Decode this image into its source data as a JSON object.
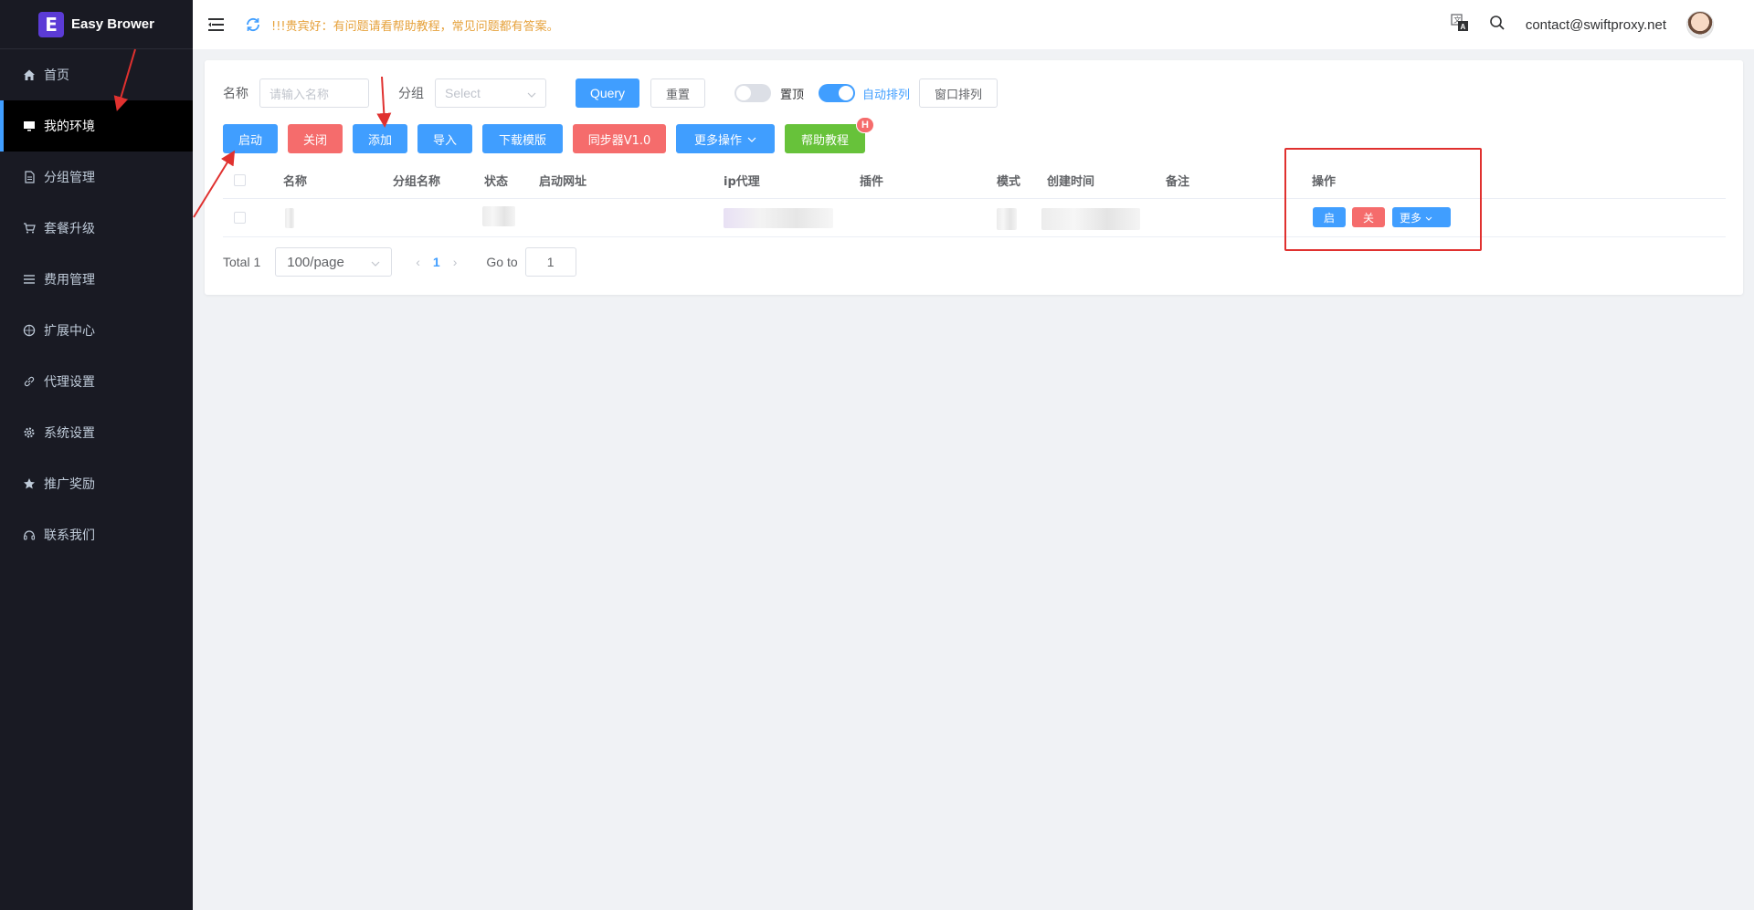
{
  "app": {
    "logo_letter": "E",
    "logo_text": "Easy Brower"
  },
  "sidebar": {
    "items": [
      {
        "label": "首页",
        "icon": "home-icon"
      },
      {
        "label": "我的环境",
        "icon": "monitor-icon",
        "active": true
      },
      {
        "label": "分组管理",
        "icon": "document-icon"
      },
      {
        "label": "套餐升级",
        "icon": "cart-icon"
      },
      {
        "label": "费用管理",
        "icon": "list-icon"
      },
      {
        "label": "扩展中心",
        "icon": "compass-icon"
      },
      {
        "label": "代理设置",
        "icon": "link-icon"
      },
      {
        "label": "系统设置",
        "icon": "gear-icon"
      },
      {
        "label": "推广奖励",
        "icon": "star-icon"
      },
      {
        "label": "联系我们",
        "icon": "headset-icon"
      }
    ]
  },
  "header": {
    "notice": "!!!贵宾好：有问题请看帮助教程，常见问题都有答案。",
    "email": "contact@swiftproxy.net"
  },
  "filters": {
    "name_label": "名称",
    "name_placeholder": "请输入名称",
    "group_label": "分组",
    "group_placeholder": "Select",
    "query_label": "Query",
    "reset_label": "重置",
    "pin_label": "置顶",
    "pin_on": false,
    "auto_arrange_label": "自动排列",
    "auto_arrange_on": true,
    "window_arrange_label": "窗口排列"
  },
  "actions": {
    "start": "启动",
    "close": "关闭",
    "add": "添加",
    "import": "导入",
    "download_template": "下载模版",
    "syncer": "同步器V1.0",
    "more_actions": "更多操作",
    "help": "帮助教程",
    "help_badge": "H"
  },
  "table": {
    "columns": {
      "name": "名称",
      "group_name": "分组名称",
      "status": "状态",
      "start_url": "启动网址",
      "ip_proxy": "ip代理",
      "plugin": "插件",
      "mode": "模式",
      "created_at": "创建时间",
      "remark": "备注",
      "operation": "操作"
    },
    "row_actions": {
      "start": "启",
      "close": "关",
      "more": "更多"
    }
  },
  "pagination": {
    "total": "Total 1",
    "page_size": "100/page",
    "current_page": "1",
    "goto_label": "Go to",
    "goto_value": "1"
  },
  "colors": {
    "primary": "#409eff",
    "danger": "#f56c6c",
    "success": "#67c23a",
    "sidebar_bg": "#191a23",
    "annotation_red": "#e0312f",
    "notice": "#e6a23c"
  }
}
